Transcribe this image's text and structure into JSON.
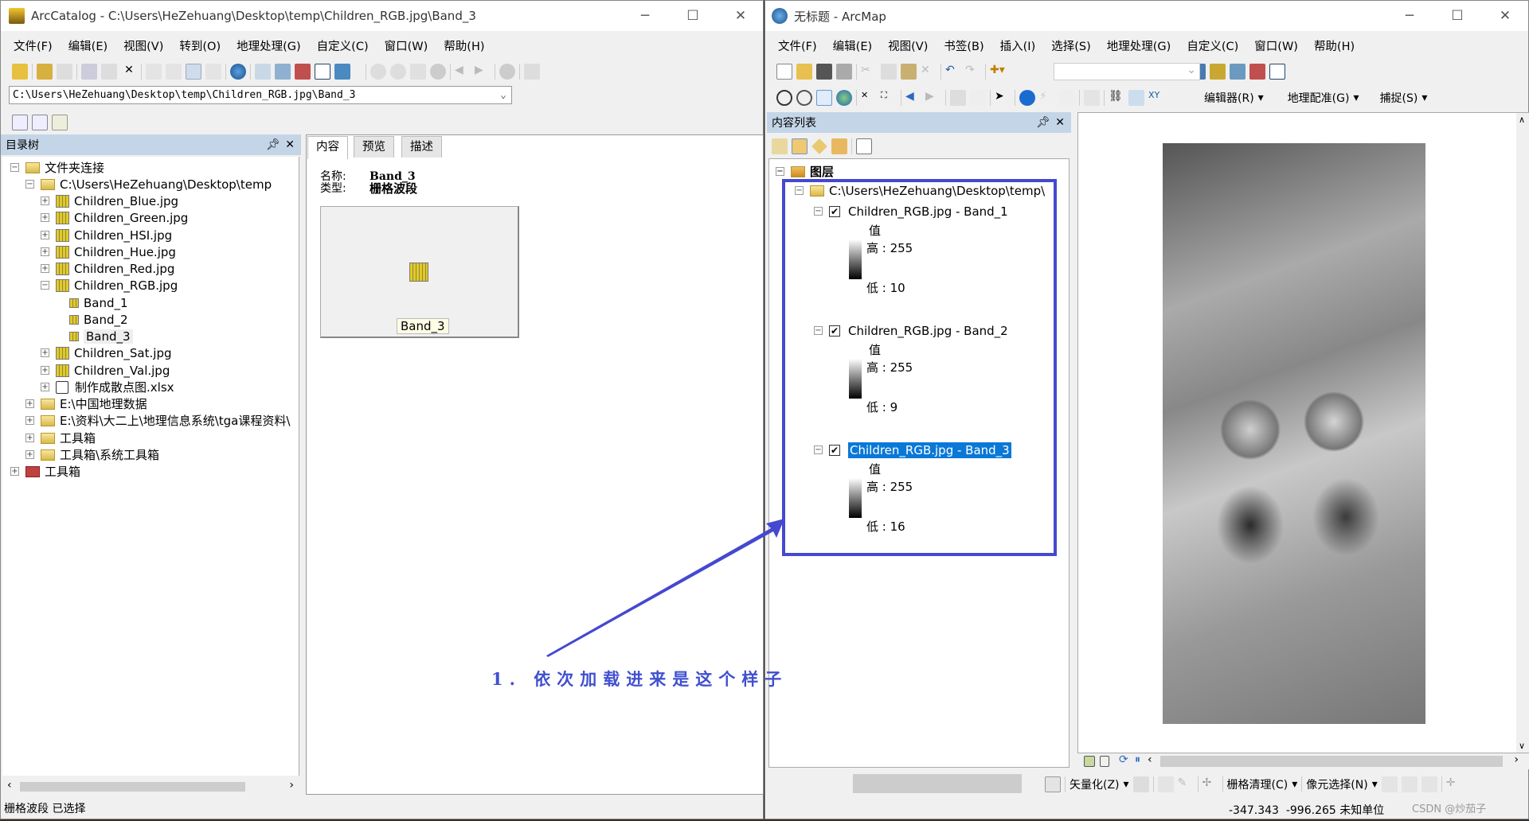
{
  "catalog": {
    "title": "ArcCatalog - C:\\Users\\HeZehuang\\Desktop\\temp\\Children_RGB.jpg\\Band_3",
    "menu": [
      "文件(F)",
      "编辑(E)",
      "视图(V)",
      "转到(O)",
      "地理处理(G)",
      "自定义(C)",
      "窗口(W)",
      "帮助(H)"
    ],
    "address": "C:\\Users\\HeZehuang\\Desktop\\temp\\Children_RGB.jpg\\Band_3",
    "tree_title": "目录树",
    "tree": [
      "文件夹连接",
      "C:\\Users\\HeZehuang\\Desktop\\temp",
      "Children_Blue.jpg",
      "Children_Green.jpg",
      "Children_HSI.jpg",
      "Children_Hue.jpg",
      "Children_Red.jpg",
      "Children_RGB.jpg",
      "Band_1",
      "Band_2",
      "Band_3",
      "Children_Sat.jpg",
      "Children_Val.jpg",
      "制作成散点图.xlsx",
      "E:\\中国地理数据",
      "E:\\资料\\大二上\\地理信息系统\\tga课程资料\\",
      "工具箱",
      "工具箱\\系统工具箱",
      "工具箱"
    ],
    "tabs": [
      "内容",
      "预览",
      "描述"
    ],
    "name_label": "名称:",
    "name_value": "Band_3",
    "type_label": "类型:",
    "type_value": "栅格波段",
    "thumb_label": "Band_3",
    "status": "栅格波段 已选择"
  },
  "arcmap": {
    "title": "无标题 - ArcMap",
    "menu": [
      "文件(F)",
      "编辑(E)",
      "视图(V)",
      "书签(B)",
      "插入(I)",
      "选择(S)",
      "地理处理(G)",
      "自定义(C)",
      "窗口(W)",
      "帮助(H)"
    ],
    "toolbar_menus": [
      "编辑器(R)",
      "地理配准(G)",
      "捕捉(S)"
    ],
    "toc_title": "内容列表",
    "layers_root": "图层",
    "folder": "C:\\Users\\HeZehuang\\Desktop\\temp\\",
    "value_label": "值",
    "layers": [
      {
        "name": "Children_RGB.jpg - Band_1",
        "high": "高 : 255",
        "low": "低 : 10",
        "checked": true
      },
      {
        "name": "Children_RGB.jpg - Band_2",
        "high": "高 : 255",
        "low": "低 : 9",
        "checked": true
      },
      {
        "name": "Children_RGB.jpg - Band_3",
        "high": "高 : 255",
        "low": "低 : 16",
        "checked": true,
        "selected": true
      }
    ],
    "bottom_tools": [
      "矢量化(Z)",
      "栅格清理(C)",
      "像元选择(N)"
    ],
    "coords": "-347.343  -996.265 未知单位",
    "watermark": "CSDN @炒茄子"
  },
  "annotation": {
    "text": "1. 依次加载进来是这个样子",
    "color": "#4050d0"
  }
}
